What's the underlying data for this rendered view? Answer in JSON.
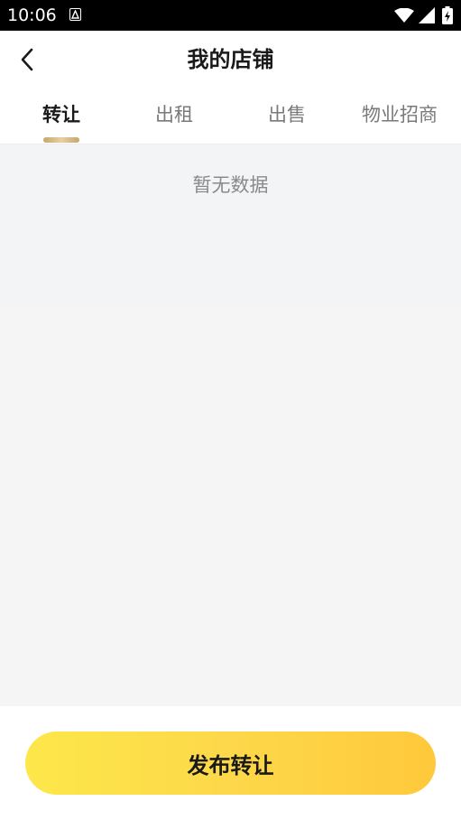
{
  "status_bar": {
    "time": "10:06",
    "icons": [
      "notification-icon",
      "wifi-icon",
      "signal-icon",
      "battery-charging-icon"
    ]
  },
  "header": {
    "back_icon": "chevron-left-icon",
    "title": "我的店铺"
  },
  "tabs": [
    {
      "label": "转让",
      "active": true
    },
    {
      "label": "出租",
      "active": false
    },
    {
      "label": "出售",
      "active": false
    },
    {
      "label": "物业招商",
      "active": false
    }
  ],
  "empty_state": {
    "text": "暂无数据"
  },
  "bottom": {
    "publish_label": "发布转让"
  },
  "colors": {
    "accent_gold": "#c9a46b",
    "button_yellow": "#fdd84a",
    "text_dark": "#1a1a1a",
    "text_muted": "#8a8a8a"
  }
}
